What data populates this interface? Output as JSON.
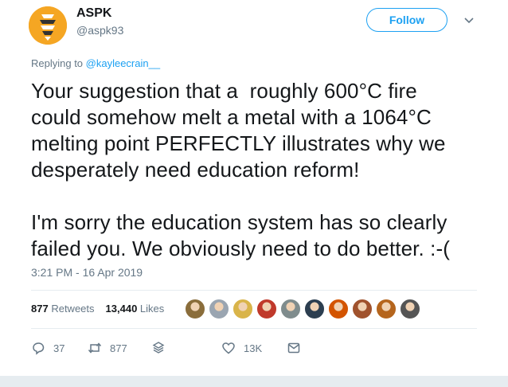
{
  "author": {
    "name": "ASPK",
    "handle": "@aspk93"
  },
  "follow_label": "Follow",
  "replying": {
    "prefix": "Replying to ",
    "target": "@kayleecrain__"
  },
  "tweet_text": "Your suggestion that a  roughly 600°C fire\ncould somehow melt a metal with a 1064°C\nmelting point PERFECTLY illustrates why we\ndesperately need education reform!\n\nI'm sorry the education system has so clearly\nfailed you. We obviously need to do better. :-(",
  "timestamp": "3:21 PM - 16 Apr 2019",
  "stats": {
    "retweets_count": "877",
    "retweets_label": "Retweets",
    "likes_count": "13,440",
    "likes_label": "Likes"
  },
  "liker_avatar_colors": [
    "#8a6d3b",
    "#9aa5b1",
    "#d9b44a",
    "#c0392b",
    "#7f8c8d",
    "#2c3e50",
    "#d35400",
    "#a0522d",
    "#b5651d",
    "#555555"
  ],
  "actions": {
    "reply_count": "37",
    "retweet_count": "877",
    "like_count": "13K"
  },
  "colors": {
    "accent": "#1da1f2",
    "muted": "#657786",
    "text": "#14171a",
    "avatar_bg": "#f5a623"
  },
  "icons": [
    "chevron-down-icon",
    "reply-icon",
    "retweet-icon",
    "stack-icon",
    "heart-icon",
    "mail-icon"
  ]
}
